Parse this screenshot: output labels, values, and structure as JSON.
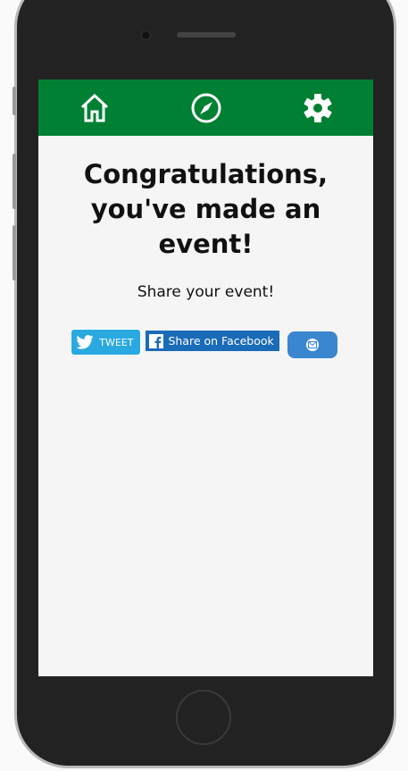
{
  "nav": {
    "icons": [
      "home-icon",
      "compass-icon",
      "gear-icon"
    ],
    "color": "#008033"
  },
  "main": {
    "title": "Congratulations, you've made an event!",
    "subtitle": "Share your event!",
    "share": {
      "tweet_label": "TWEET",
      "facebook_label": "Share on Facebook",
      "email_icon": "envelope-icon"
    }
  }
}
